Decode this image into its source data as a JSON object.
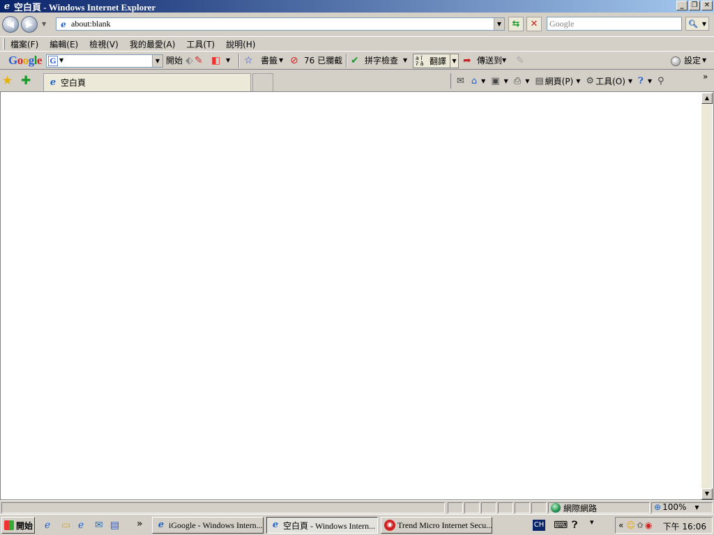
{
  "window": {
    "title": "空白頁 - Windows Internet Explorer",
    "buttons": {
      "minimize": "_",
      "maximize": "❐",
      "close": "✕"
    }
  },
  "address_bar": {
    "url": "about:blank",
    "search_placeholder": "Google"
  },
  "menu": {
    "items": [
      "檔案(F)",
      "編輯(E)",
      "檢視(V)",
      "我的最愛(A)",
      "工具(T)",
      "說明(H)"
    ]
  },
  "google_toolbar": {
    "logo": {
      "g1": "G",
      "o1": "o",
      "o2": "o",
      "g2": "g",
      "l": "l",
      "e": "e"
    },
    "search_value": "",
    "go_label": "開始",
    "bookmarks_label": "書籤",
    "blocked_label": "76 已攔截",
    "spellcheck_label": "拼字檢查",
    "translate_label": "翻譯",
    "sendto_label": "傳送到",
    "settings_label": "設定"
  },
  "tabs": {
    "active_label": "空白頁"
  },
  "command_bar": {
    "page_label": "網頁(P)",
    "tools_label": "工具(O)"
  },
  "status_bar": {
    "zone": "網際網路",
    "zoom": "100%"
  },
  "taskbar": {
    "start_label": "開始",
    "tasks": [
      "iGoogle - Windows Intern...",
      "空白頁 - Windows Intern...",
      "Trend Micro Internet Secu..."
    ],
    "lang": "CH",
    "clock": "下午 16:06"
  },
  "colors": {
    "title_gradient_start": "#0a246a",
    "title_gradient_end": "#a6caf0",
    "chrome": "#d4d0c8"
  }
}
